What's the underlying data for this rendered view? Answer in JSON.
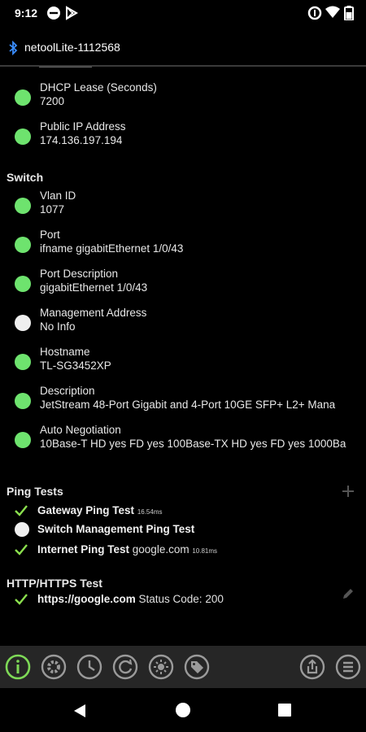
{
  "status": {
    "time": "9:12"
  },
  "app": {
    "title": "netoolLite-1112568"
  },
  "top_items": [
    {
      "label": "DHCP Lease (Seconds)",
      "value": "7200",
      "status": "green"
    },
    {
      "label": "Public IP Address",
      "value": "174.136.197.194",
      "status": "green"
    }
  ],
  "switch": {
    "header": "Switch",
    "items": [
      {
        "label": "Vlan ID",
        "value": "1077",
        "status": "green"
      },
      {
        "label": "Port",
        "value": "ifname gigabitEthernet 1/0/43",
        "status": "green"
      },
      {
        "label": "Port Description",
        "value": "gigabitEthernet 1/0/43",
        "status": "green"
      },
      {
        "label": "Management Address",
        "value": "No Info",
        "status": "white"
      },
      {
        "label": "Hostname",
        "value": "TL-SG3452XP",
        "status": "green"
      },
      {
        "label": "Description",
        "value": "JetStream 48-Port Gigabit and 4-Port 10GE SFP+ L2+ Mana",
        "status": "green"
      },
      {
        "label": "Auto Negotiation",
        "value": "10Base-T HD yes FD yes 100Base-TX HD yes FD yes 1000Ba",
        "status": "green"
      }
    ]
  },
  "ping": {
    "header": "Ping Tests",
    "tests": [
      {
        "name": "Gateway Ping Test",
        "detail": "",
        "time": "16.54ms",
        "status": "pass"
      },
      {
        "name": "Switch Management Ping Test",
        "detail": "",
        "time": "",
        "status": "none"
      },
      {
        "name": "Internet Ping Test",
        "detail": "google.com",
        "time": "10.81ms",
        "status": "pass"
      }
    ]
  },
  "http": {
    "header": "HTTP/HTTPS Test",
    "tests": [
      {
        "name": "https://google.com",
        "detail": "Status Code: 200",
        "status": "pass"
      }
    ]
  },
  "colors": {
    "green": "#6ee36e",
    "accent": "#7ed957",
    "toolbar": "#262626"
  },
  "toolbar": {
    "items": [
      "info-icon",
      "settings-icon",
      "history-icon",
      "refresh-icon",
      "brightness-icon",
      "tag-icon",
      "share-icon",
      "menu-icon"
    ]
  }
}
